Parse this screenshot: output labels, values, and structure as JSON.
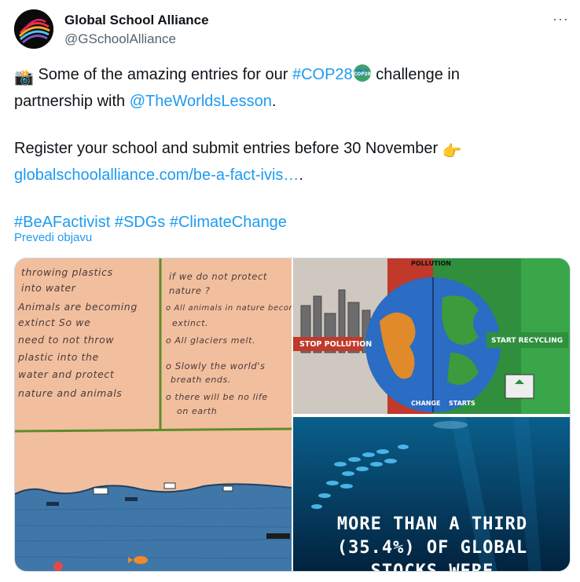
{
  "account": {
    "display_name": "Global School Alliance",
    "handle": "@GSchoolAlliance",
    "more_label": "···"
  },
  "tweet": {
    "line1_emoji": "📸",
    "line1_text": " Some of the amazing entries for our ",
    "hashtag_cop": "#COP28",
    "line1_end": " challenge in",
    "line2_text": "partnership with ",
    "mention": "@TheWorldsLesson",
    "line2_end": ".",
    "line3_text": "Register your school and submit entries before 30 November ",
    "line3_emoji": "👉",
    "link": "globalschoolalliance.com/be-a-fact-ivis…",
    "link_end": ".",
    "hashtag_1": "#BeAFactivist",
    "hashtag_2": "#SDGs",
    "hashtag_3": "#ClimateChange",
    "translate": "Prevedi objavu"
  },
  "media": {
    "left_poster": {
      "col1": [
        "throwing plastics",
        "into water",
        "Animals are becoming",
        "extinct  So  we",
        "need  to  not  throw",
        "plastic  into  the",
        "water  and  protect",
        "nature  and  animals"
      ],
      "col2": [
        "if we do not protect",
        "nature ?",
        "o All animals in nature become",
        "extinct.",
        "o All glaciers melt.",
        "o Slowly the world's",
        "breath ends.",
        "o there will be no life",
        "on earth"
      ]
    },
    "top_right": {
      "sign_pollution": "STOP POLLUTION",
      "sign_recycling": "START RECYCLING",
      "banner_top": "POLLUTION",
      "banner_bottom_1": "CHANGE",
      "banner_bottom_2": "STARTS"
    },
    "bottom_right": {
      "line1": "MORE THAN A THIRD",
      "line2": "(35.4%) OF GLOBAL",
      "line3": "STOCKS WERE"
    }
  },
  "colors": {
    "link": "#1d9bf0",
    "text": "#0f1419",
    "muted": "#536471"
  }
}
